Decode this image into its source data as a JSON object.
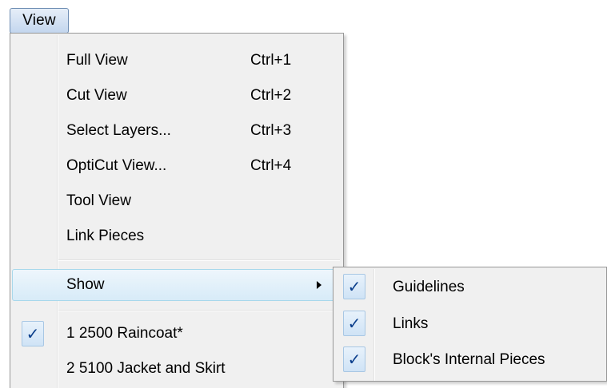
{
  "menubar": {
    "view_label": "View"
  },
  "menu": {
    "items": [
      {
        "label": "Full View",
        "shortcut": "Ctrl+1"
      },
      {
        "label": "Cut View",
        "shortcut": "Ctrl+2"
      },
      {
        "label": "Select Layers...",
        "shortcut": "Ctrl+3"
      },
      {
        "label": "OptiCut View...",
        "shortcut": "Ctrl+4"
      },
      {
        "label": "Tool View",
        "shortcut": ""
      },
      {
        "label": "Link Pieces",
        "shortcut": ""
      }
    ],
    "show": {
      "label": "Show",
      "has_submenu": true
    },
    "recent": [
      {
        "label": "1 2500 Raincoat*",
        "checked": true
      },
      {
        "label": "2 5100 Jacket and Skirt",
        "checked": false
      }
    ]
  },
  "submenu": {
    "items": [
      {
        "label": "Guidelines",
        "checked": true
      },
      {
        "label": "Links",
        "checked": true
      },
      {
        "label": "Block's Internal Pieces",
        "checked": true
      }
    ]
  },
  "check_glyph": "✓",
  "colors": {
    "menu_background": "#f0f0f0",
    "highlight_border": "#a8d8eb",
    "highlight_fill": "#d7ebf8",
    "check_color": "#0c3f8c"
  },
  "icons": {
    "check": "checkmark-icon",
    "submenu_arrow": "chevron-right-icon"
  }
}
